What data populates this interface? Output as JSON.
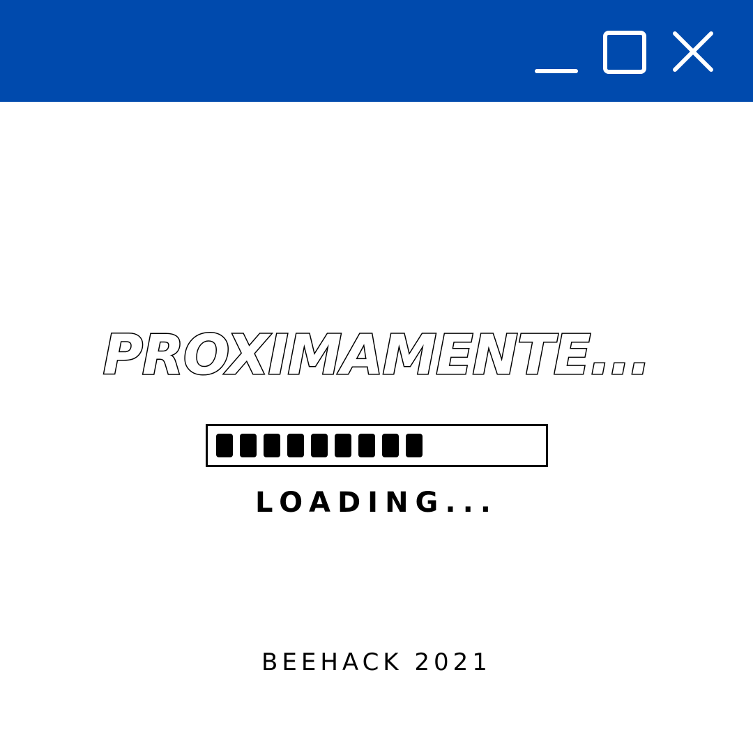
{
  "window": {
    "titlebar_color": "#004aad",
    "controls": [
      {
        "name": "minimize",
        "icon": "minimize-icon"
      },
      {
        "name": "maximize",
        "icon": "maximize-icon"
      },
      {
        "name": "close",
        "icon": "close-icon"
      }
    ]
  },
  "main": {
    "headline": "PROXIMAMENTE...",
    "progress": {
      "filled_segments": 9,
      "value_fraction": 0.6
    },
    "loading_label": "LOADING...",
    "footer": "BEEHACK 2021"
  },
  "colors": {
    "accent": "#004aad",
    "text": "#000000",
    "background": "#ffffff"
  }
}
